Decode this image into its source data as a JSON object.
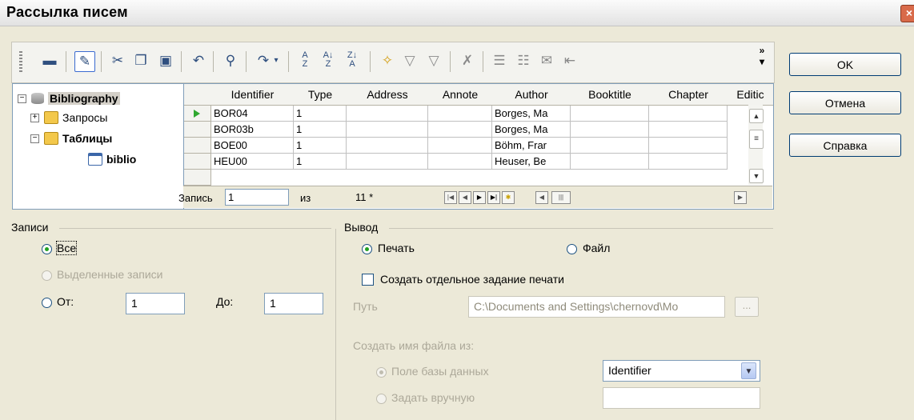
{
  "window": {
    "title": "Рассылка писем"
  },
  "toolbar": {
    "icons": [
      "save-record-icon",
      "edit-data-icon",
      "cut-icon",
      "copy-icon",
      "paste-icon",
      "undo-icon",
      "find-icon",
      "sort-order-icon",
      "sort-icon",
      "sort-ascending-icon",
      "sort-descending-icon",
      "autofilter-icon",
      "standard-filter-icon",
      "apply-filter-icon",
      "remove-filter-icon",
      "data-to-text-icon",
      "data-to-fields-icon",
      "mail-merge-icon",
      "data-source-icon"
    ],
    "overflow_glyph": "»"
  },
  "tree": {
    "root": "Bibliography",
    "queries": "Запросы",
    "tables": "Таблицы",
    "table": "biblio"
  },
  "grid": {
    "columns": [
      "Identifier",
      "Type",
      "Address",
      "Annote",
      "Author",
      "Booktitle",
      "Chapter",
      "Editic"
    ],
    "rows": [
      [
        "BOR04",
        "1",
        "",
        "",
        "Borges, Ma",
        "",
        "",
        ""
      ],
      [
        "BOR03b",
        "1",
        "",
        "",
        "Borges, Ma",
        "",
        "",
        ""
      ],
      [
        "BOE00",
        "1",
        "",
        "",
        "Böhm, Frar",
        "",
        "",
        ""
      ],
      [
        "HEU00",
        "1",
        "",
        "",
        "Heuser, Be",
        "",
        "",
        ""
      ]
    ]
  },
  "nav": {
    "record_label": "Запись",
    "record_value": "1",
    "of_label": "из",
    "total": "11 *"
  },
  "buttons": {
    "ok": "OK",
    "cancel": "Отмена",
    "help": "Справка"
  },
  "records": {
    "legend": "Записи",
    "all": "Все",
    "selected": "Выделенные записи",
    "from": "От:",
    "from_value": "1",
    "to": "До:",
    "to_value": "1"
  },
  "output": {
    "legend": "Вывод",
    "print": "Печать",
    "file": "Файл",
    "separate_job": "Создать отдельное задание печати",
    "path_label": "Путь",
    "path_value": "C:\\Documents and Settings\\chernovd\\Mo",
    "browse": "...",
    "filename_from": "Создать имя файла из:",
    "db_field": "Поле базы данных",
    "db_field_value": "Identifier",
    "manual": "Задать вручную",
    "manual_value": ""
  }
}
